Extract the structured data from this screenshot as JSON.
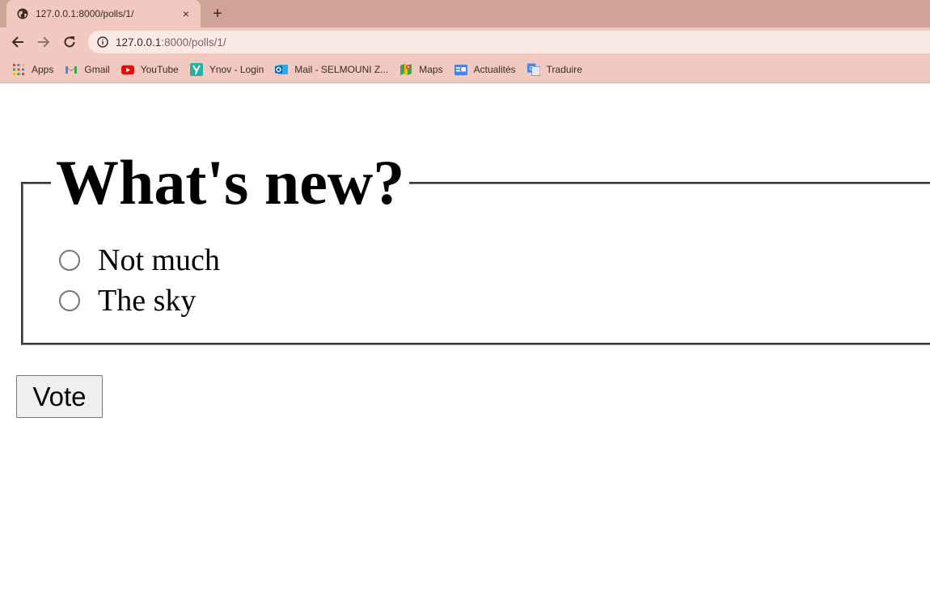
{
  "tab": {
    "title": "127.0.0.1:8000/polls/1/",
    "close_glyph": "×",
    "new_tab_glyph": "+"
  },
  "address_bar": {
    "url_host": "127.0.0.1",
    "url_rest": ":8000/polls/1/"
  },
  "bookmarks": [
    {
      "label": "Apps",
      "icon": "apps-grid-icon"
    },
    {
      "label": "Gmail",
      "icon": "gmail-icon"
    },
    {
      "label": "YouTube",
      "icon": "youtube-icon"
    },
    {
      "label": "Ynov - Login",
      "icon": "ynov-icon"
    },
    {
      "label": "Mail - SELMOUNI Z...",
      "icon": "outlook-icon"
    },
    {
      "label": "Maps",
      "icon": "maps-icon"
    },
    {
      "label": "Actualités",
      "icon": "news-icon"
    },
    {
      "label": "Traduire",
      "icon": "translate-icon"
    }
  ],
  "poll": {
    "question": "What's new?",
    "choices": [
      {
        "label": "Not much",
        "selected": false
      },
      {
        "label": "The sky",
        "selected": false
      }
    ],
    "vote_label": "Vote"
  },
  "colors": {
    "tabstrip": "#cfa398",
    "toolbar": "#f1c9c0",
    "omnibox": "#fbe9e6"
  }
}
